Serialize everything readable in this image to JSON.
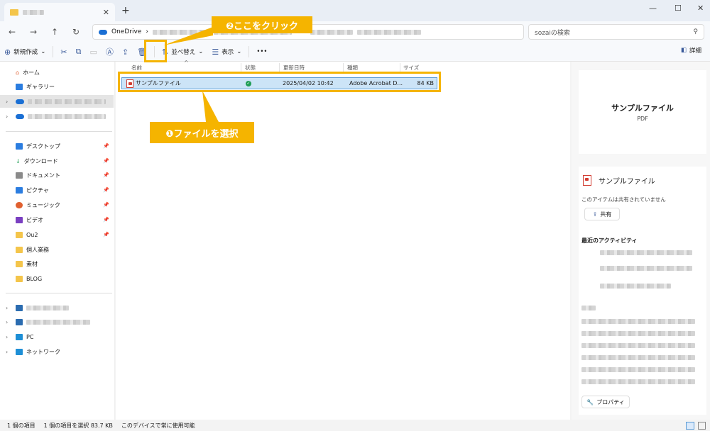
{
  "window": {
    "tab_close": "✕",
    "new_tab": "+",
    "minimize": "—",
    "maximize": "☐",
    "close": "✕"
  },
  "address": {
    "location": "OneDrive",
    "search_placeholder": "sozaiの検索"
  },
  "toolbar": {
    "new_label": "新規作成",
    "sort_label": "並べ替え",
    "view_label": "表示",
    "more_label": "•••",
    "details_label": "詳細"
  },
  "sidebar": {
    "home": "ホーム",
    "gallery": "ギャラリー",
    "quick": [
      {
        "label": "デスクトップ",
        "color": "#2b7de0"
      },
      {
        "label": "ダウンロード",
        "color": "#1f9d55"
      },
      {
        "label": "ドキュメント",
        "color": "#8a8a8a"
      },
      {
        "label": "ピクチャ",
        "color": "#2b7de0"
      },
      {
        "label": "ミュージック",
        "color": "#e06030"
      },
      {
        "label": "ビデオ",
        "color": "#7a3fc1"
      },
      {
        "label": "Ou2",
        "color": "#f4c54b"
      },
      {
        "label": "個人業務",
        "color": "#f4c54b"
      },
      {
        "label": "素材",
        "color": "#f4c54b"
      },
      {
        "label": "BLOG",
        "color": "#f4c54b"
      }
    ],
    "pc": "PC",
    "network": "ネットワーク"
  },
  "columns": {
    "name": "名前",
    "status": "状態",
    "date": "更新日時",
    "type": "種類",
    "size": "サイズ"
  },
  "file": {
    "name": "サンプルファイル",
    "date": "2025/04/02 10:42",
    "type": "Adobe Acrobat D...",
    "size": "84 KB"
  },
  "annotations": {
    "step1": "❶ファイルを選択",
    "step2": "❷ここをクリック"
  },
  "details": {
    "title": "サンプルファイル",
    "subtitle": "PDF",
    "file_name": "サンプルファイル",
    "share_status": "このアイテムは共有されていません",
    "share_button": "共有",
    "activity_heading": "最近のアクティビティ",
    "properties_button": "プロパティ"
  },
  "status": {
    "count": "1 個の項目",
    "selected": "1 個の項目を選択  83.7 KB",
    "availability": "このデバイスで常に使用可能"
  },
  "colors": {
    "accent": "#f5b400",
    "selection": "#cce4f7",
    "sync_ok": "#1f9d55"
  }
}
